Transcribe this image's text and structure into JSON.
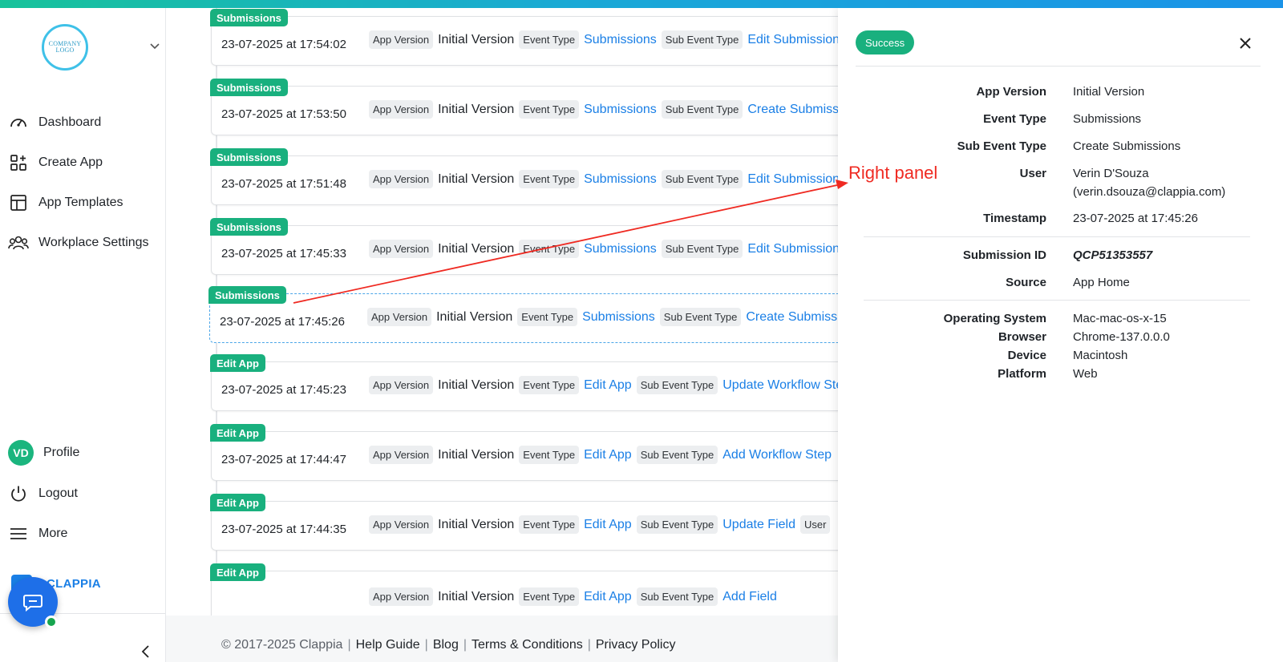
{
  "sidebar": {
    "logo_text": "COMPANY LOGO",
    "nav": [
      {
        "label": "Dashboard",
        "icon": "gauge-icon"
      },
      {
        "label": "Create App",
        "icon": "add-app-icon"
      },
      {
        "label": "App Templates",
        "icon": "templates-icon"
      },
      {
        "label": "Workplace Settings",
        "icon": "users-icon"
      }
    ],
    "profile": {
      "initials": "VD",
      "label": "Profile"
    },
    "logout_label": "Logout",
    "more_label": "More",
    "brand_text": "CLAPPIA"
  },
  "labels": {
    "app_version": "App Version",
    "event_type": "Event Type",
    "sub_event_type": "Sub Event Type",
    "user": "User"
  },
  "entries": [
    {
      "badge": "Submissions",
      "timestamp": "23-07-2025 at 17:54:02",
      "app_version": "Initial Version",
      "event_type": "Submissions",
      "sub_event": "Edit Submission"
    },
    {
      "badge": "Submissions",
      "timestamp": "23-07-2025 at 17:53:50",
      "app_version": "Initial Version",
      "event_type": "Submissions",
      "sub_event": "Create Submissions"
    },
    {
      "badge": "Submissions",
      "timestamp": "23-07-2025 at 17:51:48",
      "app_version": "Initial Version",
      "event_type": "Submissions",
      "sub_event": "Edit Submission"
    },
    {
      "badge": "Submissions",
      "timestamp": "23-07-2025 at 17:45:33",
      "app_version": "Initial Version",
      "event_type": "Submissions",
      "sub_event": "Edit Submission"
    },
    {
      "badge": "Submissions",
      "timestamp": "23-07-2025 at 17:45:26",
      "app_version": "Initial Version",
      "event_type": "Submissions",
      "sub_event": "Create Submissions",
      "selected": true
    },
    {
      "badge": "Edit App",
      "timestamp": "23-07-2025 at 17:45:23",
      "app_version": "Initial Version",
      "event_type": "Edit App",
      "sub_event": "Update Workflow Step"
    },
    {
      "badge": "Edit App",
      "timestamp": "23-07-2025 at 17:44:47",
      "app_version": "Initial Version",
      "event_type": "Edit App",
      "sub_event": "Add Workflow Step"
    },
    {
      "badge": "Edit App",
      "timestamp": "23-07-2025 at 17:44:35",
      "app_version": "Initial Version",
      "event_type": "Edit App",
      "sub_event": "Update Field",
      "show_user": true
    },
    {
      "badge": "Edit App",
      "timestamp": "",
      "app_version": "Initial Version",
      "event_type": "Edit App",
      "sub_event": "Add Field"
    }
  ],
  "footer": {
    "copyright": "© 2017-2025 Clappia",
    "links": [
      "Help Guide",
      "Blog",
      "Terms & Conditions",
      "Privacy Policy"
    ]
  },
  "panel": {
    "status": "Success",
    "rows": [
      {
        "label": "App Version",
        "value": "Initial Version"
      },
      {
        "label": "Event Type",
        "value": "Submissions"
      },
      {
        "label": "Sub Event Type",
        "value": "Create Submissions"
      },
      {
        "label": "User",
        "value": "Verin D'Souza",
        "value2": "(verin.dsouza@clappia.com)"
      },
      {
        "label": "Timestamp",
        "value": "23-07-2025 at 17:45:26"
      }
    ],
    "submission": [
      {
        "label": "Submission ID",
        "value": "QCP51353557"
      },
      {
        "label": "Source",
        "value": "App Home"
      }
    ],
    "device": [
      {
        "label": "Operating System",
        "value": "Mac-mac-os-x-15"
      },
      {
        "label": "Browser",
        "value": "Chrome-137.0.0.0"
      },
      {
        "label": "Device",
        "value": "Macintosh"
      },
      {
        "label": "Platform",
        "value": "Web"
      }
    ]
  },
  "annotation": {
    "text": "Right panel",
    "color": "#ef2a22"
  },
  "colors": {
    "accent_green": "#19b07e",
    "link_blue": "#1a7fe6"
  }
}
